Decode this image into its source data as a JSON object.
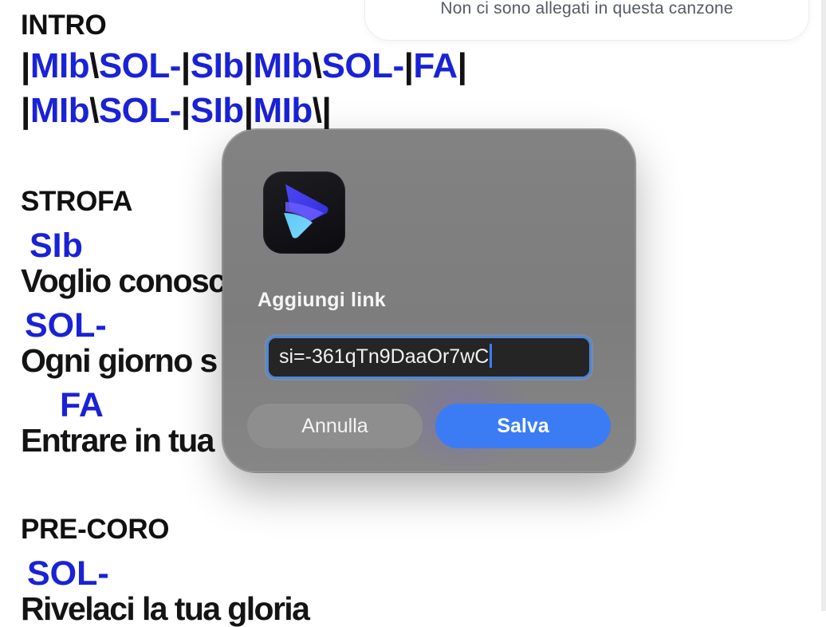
{
  "attachments": {
    "empty_text": "Non ci sono allegati in questa canzone"
  },
  "song": {
    "intro": {
      "title": "INTRO",
      "lines": [
        {
          "bars": [
            "|",
            "\\",
            "|",
            "|",
            "\\",
            "|",
            "|"
          ],
          "chords": [
            "MIb",
            "SOL-",
            "SIb",
            "MIb",
            "SOL-",
            "FA"
          ]
        },
        {
          "bars": [
            "|",
            "\\",
            "|",
            "|",
            "\\|"
          ],
          "chords": [
            "MIb",
            "SOL-",
            "SIb",
            "MIb"
          ]
        }
      ]
    },
    "strofa": {
      "title": "STROFA",
      "lines": [
        {
          "chord": "SIb",
          "lyric": "Voglio conosc"
        },
        {
          "chord": "SOL-",
          "lyric": "Ogni giorno s"
        },
        {
          "chord": "FA",
          "lyric": "Entrare in tua"
        }
      ]
    },
    "precoro": {
      "title": "PRE-CORO",
      "lines": [
        {
          "chord": "SOL-",
          "lyric": "Rivelaci la tua gloria"
        }
      ]
    }
  },
  "dialog": {
    "app_icon": "app-logo-icon",
    "title": "Aggiungi link",
    "input_value": "si=-361qTn9DaaOr7wC",
    "cancel_label": "Annulla",
    "save_label": "Salva"
  },
  "colors": {
    "chord": "#1a22d6",
    "accent": "#3b7cf5",
    "dialog_bg": "#808080",
    "input_border": "#4f86d4"
  }
}
